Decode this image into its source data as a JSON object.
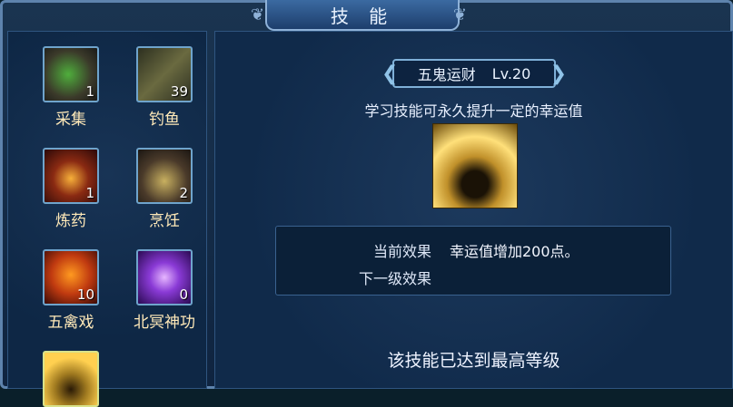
{
  "window": {
    "title": "技 能"
  },
  "skills": [
    {
      "name": "采集",
      "count": "1",
      "icon": "collect-herb-icon"
    },
    {
      "name": "钓鱼",
      "count": "39",
      "icon": "fishing-rod-icon"
    },
    {
      "name": "炼药",
      "count": "1",
      "icon": "alchemy-furnace-icon"
    },
    {
      "name": "烹饪",
      "count": "2",
      "icon": "cooking-wok-icon"
    },
    {
      "name": "五禽戏",
      "count": "10",
      "icon": "five-animals-exercise-icon"
    },
    {
      "name": "北冥神功",
      "count": "0",
      "icon": "beiming-power-icon"
    },
    {
      "name": "",
      "count": "",
      "icon": "gold-pot-icon"
    }
  ],
  "detail": {
    "skill_name": "五鬼运财",
    "level": "Lv.20",
    "description": "学习技能可永久提升一定的幸运值",
    "icon": "gold-pot-icon",
    "current_effect_label": "当前效果",
    "current_effect_value": "幸运值增加200点。",
    "next_effect_label": "下一级效果",
    "next_effect_value": "",
    "max_level_text": "该技能已达到最高等级"
  }
}
